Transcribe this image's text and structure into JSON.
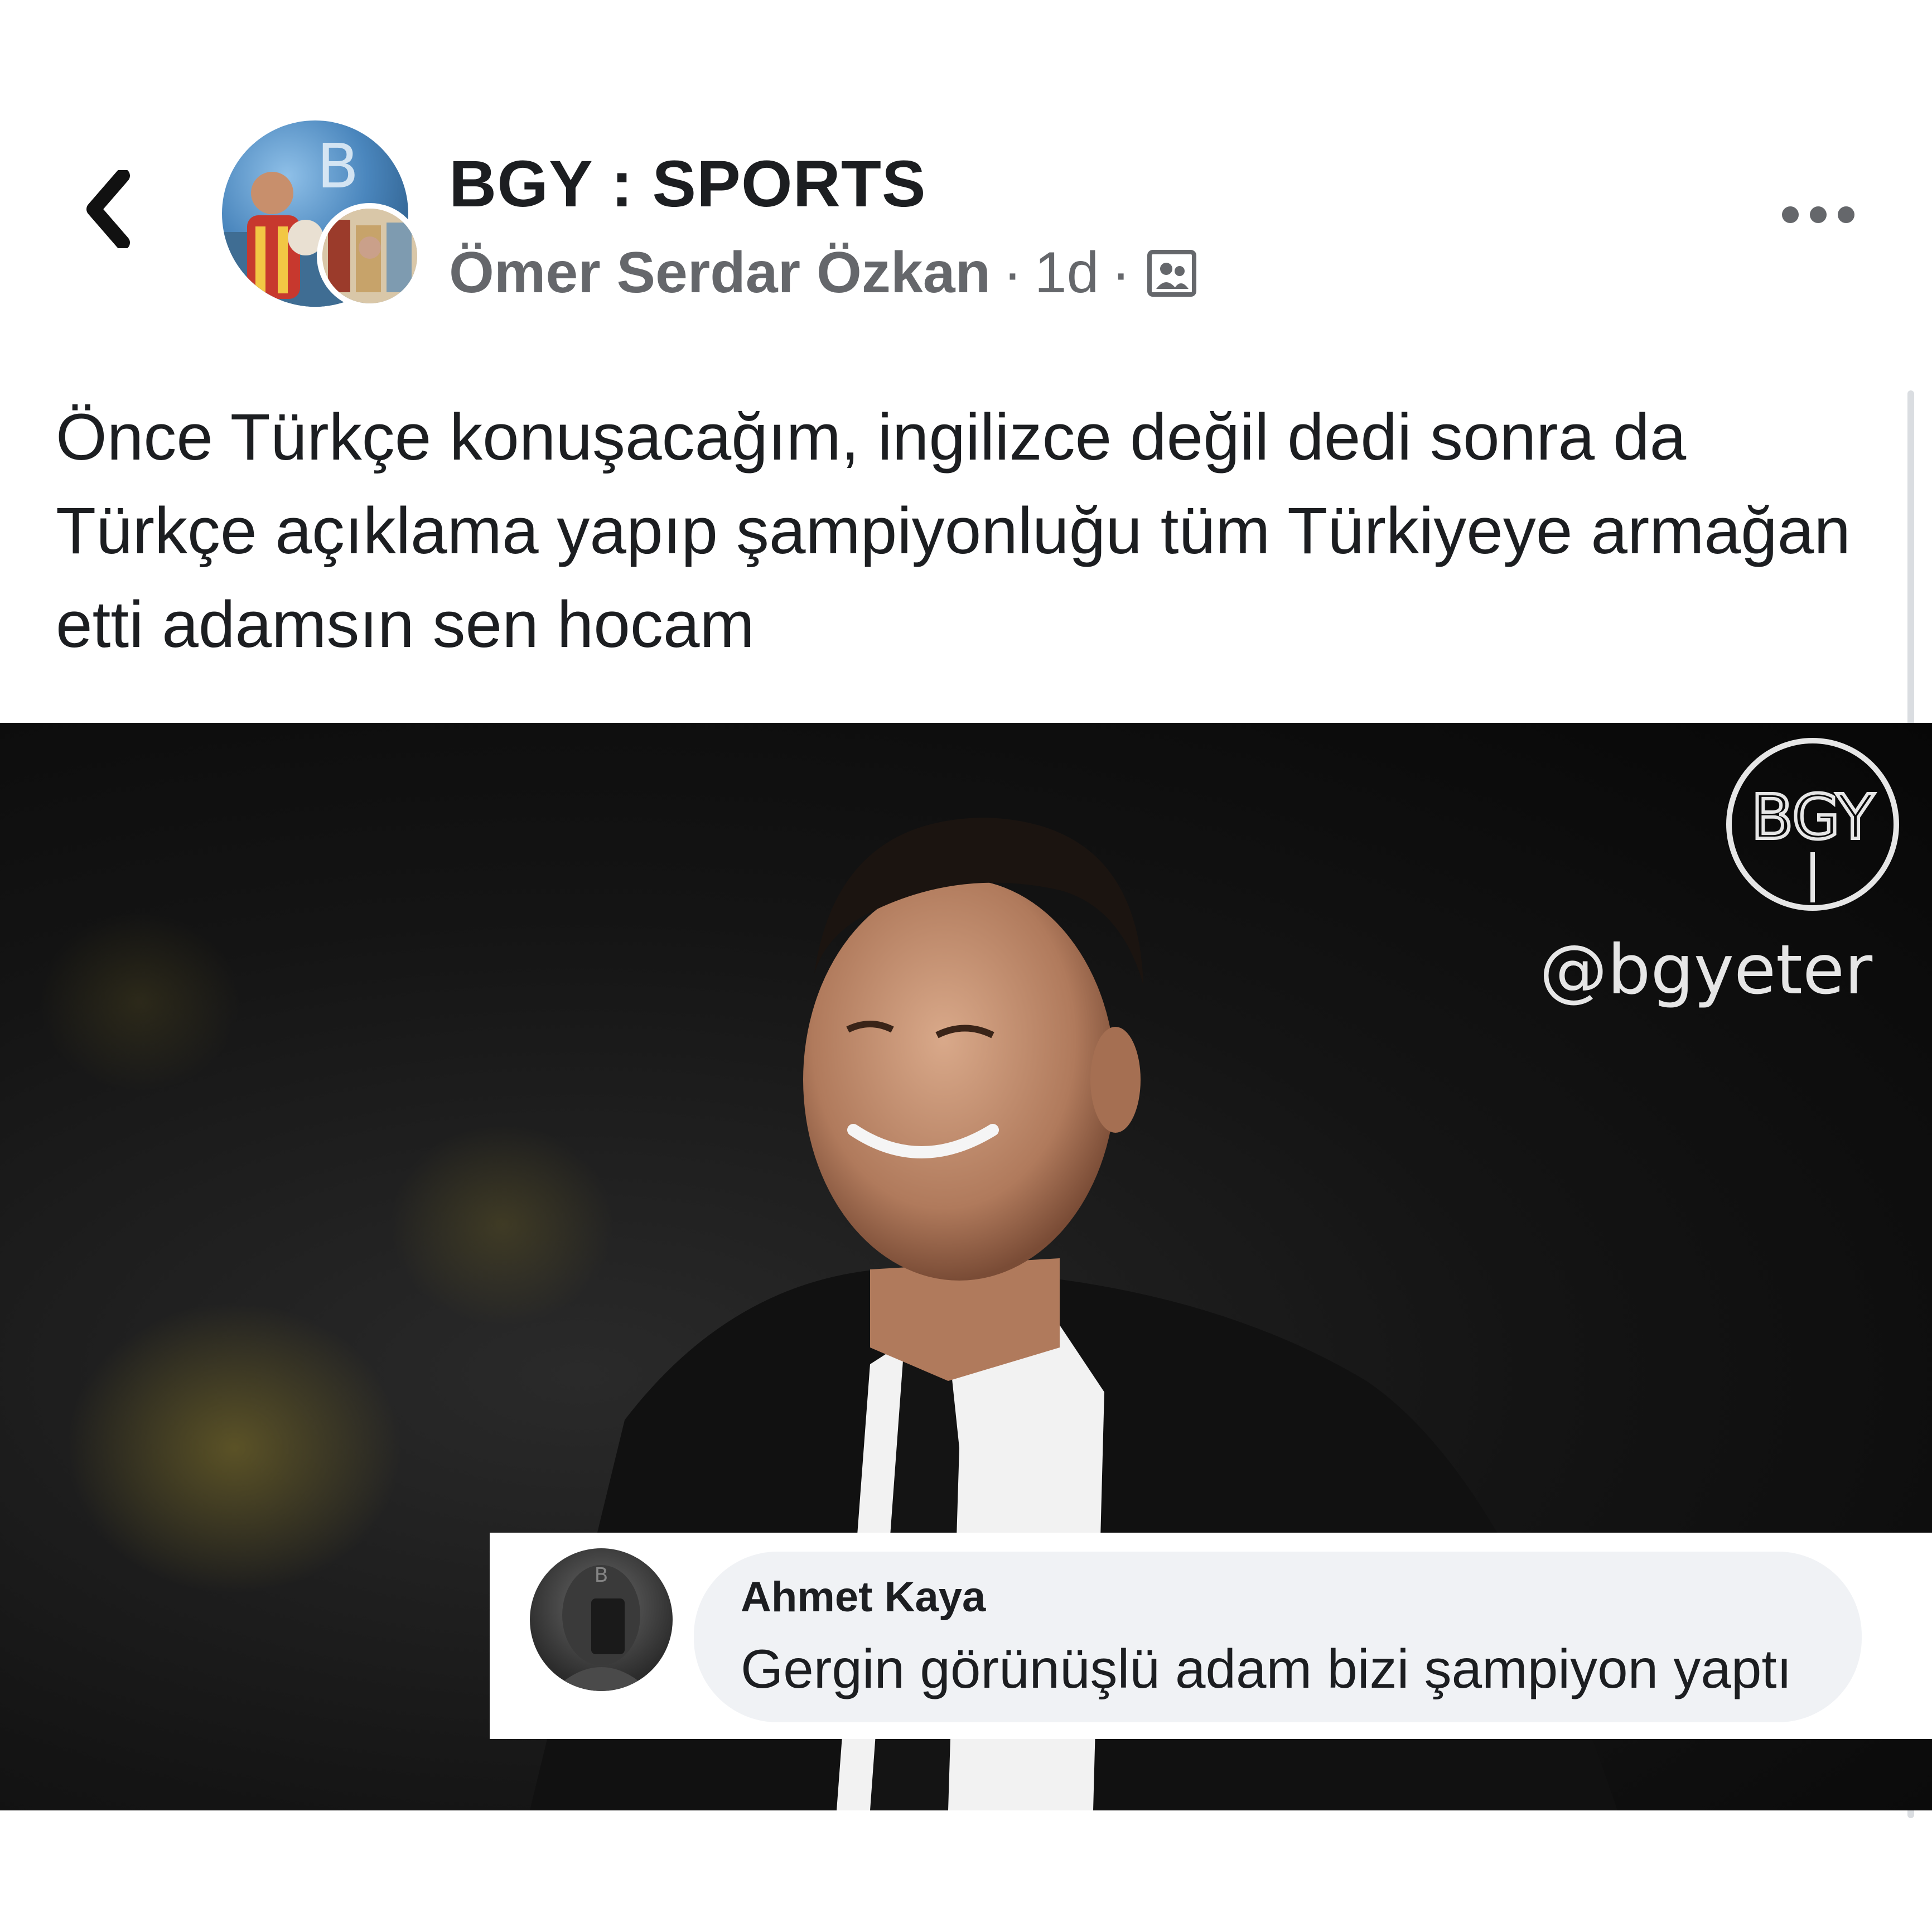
{
  "header": {
    "page_name": "BGY : SPORTS",
    "author": "Ömer Serdar Özkan",
    "separator_1": "·",
    "time": "1d",
    "separator_2": "·",
    "audience_icon": "group-icon",
    "back_icon": "chevron-left-icon",
    "more_icon": "more-dots-icon"
  },
  "post": {
    "text": "Önce Türkçe konuşacağım, ingilizce değil dedi sonra da Türkçe açıklama yapıp şampiyonluğu tüm Türkiyeye armağan etti adamsın sen hocam"
  },
  "image": {
    "watermark_logo": "BGY",
    "watermark_handle": "@bgyeter",
    "comment": {
      "author": "Ahmet Kaya",
      "text": "Gergin görünüşlü adam bizi şampiyon yaptı"
    }
  },
  "colors": {
    "text_primary": "#1c1e21",
    "text_secondary": "#65676b",
    "bubble_bg": "#f0f2f5"
  }
}
